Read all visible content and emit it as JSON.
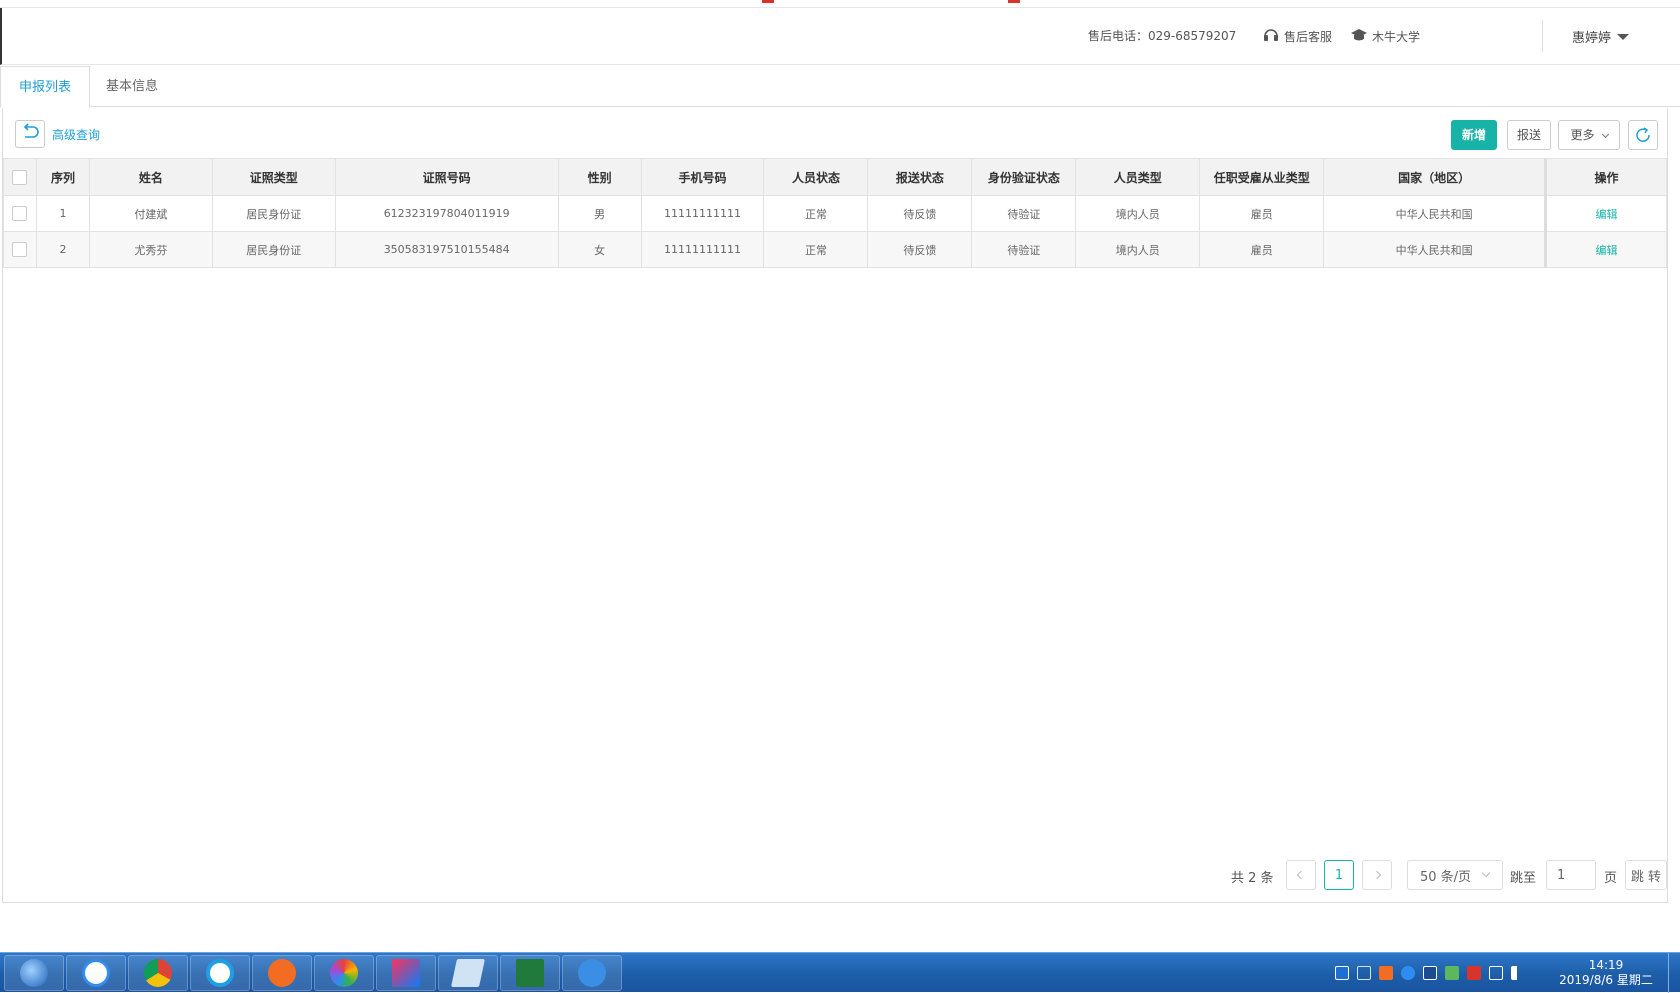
{
  "header": {
    "hotline": "售后电话：029-68579207",
    "service": "售后客服",
    "university": "木牛大学",
    "user": "惠婷婷"
  },
  "tabs": [
    {
      "label": "申报列表",
      "active": true
    },
    {
      "label": "基本信息",
      "active": false
    }
  ],
  "toolbar": {
    "advanced_query": "高级查询",
    "add": "新增",
    "report": "报送",
    "more": "更多"
  },
  "table": {
    "columns": [
      "序列",
      "姓名",
      "证照类型",
      "证照号码",
      "性别",
      "手机号码",
      "人员状态",
      "报送状态",
      "身份验证状态",
      "人员类型",
      "任职受雇从业类型",
      "国家（地区）",
      "操作"
    ],
    "rows": [
      [
        "1",
        "付建斌",
        "居民身份证",
        "612323197804011919",
        "男",
        "11111111111",
        "正常",
        "待反馈",
        "待验证",
        "境内人员",
        "雇员",
        "中华人民共和国",
        "编辑"
      ],
      [
        "2",
        "尤秀芬",
        "居民身份证",
        "350583197510155484",
        "女",
        "11111111111",
        "正常",
        "待反馈",
        "待验证",
        "境内人员",
        "雇员",
        "中华人民共和国",
        "编辑"
      ]
    ]
  },
  "pager": {
    "total": "共 2 条",
    "current_page": "1",
    "page_size": "50 条/页",
    "jump_label": "跳至",
    "jump_value": "1",
    "page_unit": "页",
    "jump_button": "跳 转"
  },
  "taskbar": {
    "time": "14:19",
    "date": "2019/8/6 星期二",
    "apps": [
      "start-orb",
      "baidu-netdisk",
      "chrome",
      "internet-explorer",
      "pen-app",
      "colorful-app",
      "intellij-idea",
      "notepad",
      "excel",
      "feishu-like"
    ]
  },
  "colors": {
    "accent": "#17b3a8",
    "link": "#1e9fd6"
  }
}
